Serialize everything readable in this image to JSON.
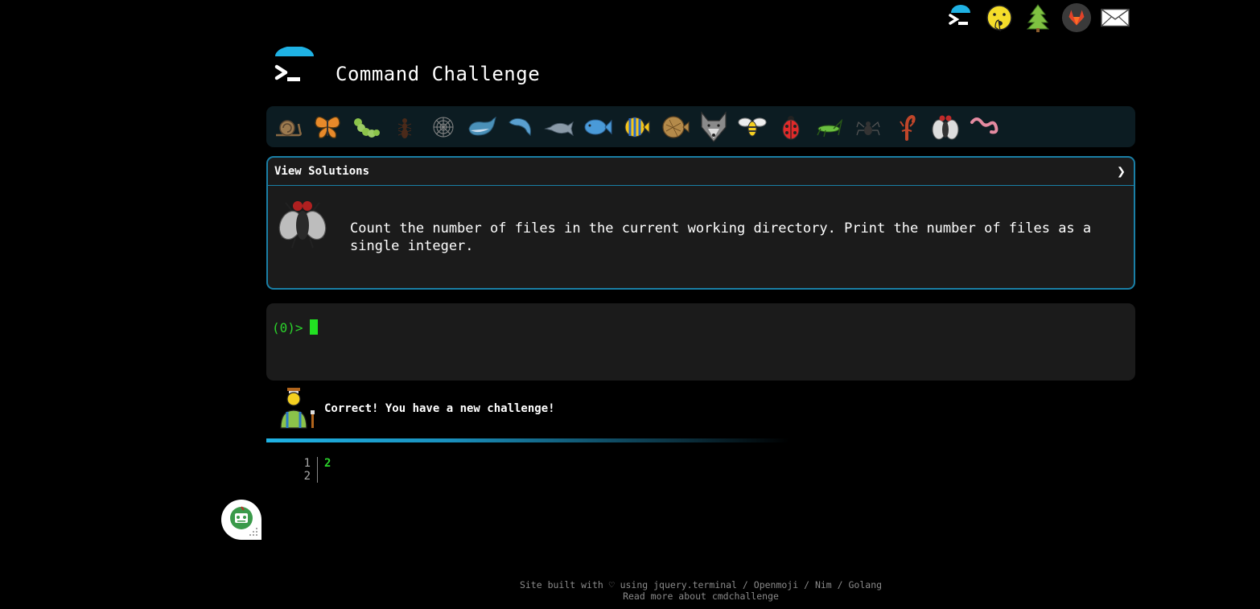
{
  "header": {
    "title": "Command Challenge"
  },
  "top_icons": [
    "cmdchallenge-logo-icon",
    "shushing-face-icon",
    "tree-icon",
    "gitlab-icon",
    "envelope-icon"
  ],
  "creatures": [
    "snail",
    "butterfly",
    "caterpillar",
    "ant",
    "spider-web",
    "whale",
    "dolphin-jumping",
    "dolphin",
    "fish",
    "tropical-fish",
    "blowfish",
    "wolf",
    "bee",
    "ladybug",
    "cricket",
    "spider",
    "scorpion",
    "fly",
    "worm"
  ],
  "panel": {
    "toggle_label": "View Solutions",
    "chevron": "❯",
    "challenge_text": "Count the number of files in the current working directory. Print the number of files as a single integer."
  },
  "terminal": {
    "prompt": "(0)>"
  },
  "feedback": {
    "message": "Correct! You have a new challenge!"
  },
  "output": {
    "lines": [
      {
        "num": "1",
        "value": "2"
      },
      {
        "num": "2",
        "value": ""
      }
    ]
  },
  "footer": {
    "line1_prefix": "Site built with ♡ using ",
    "link_jquery": "jquery.terminal",
    "sep1": " / ",
    "link_openmoji": "Openmoji",
    "sep2": " / ",
    "link_nim": "Nim",
    "sep3": " / ",
    "link_golang": "Golang",
    "line2": "Read more about cmdchallenge"
  },
  "colors": {
    "accent": "#1a7fa6",
    "prompt_green": "#2bd42b",
    "panel_bg": "#1b1b1b",
    "strip_bg": "#0c1c22"
  }
}
